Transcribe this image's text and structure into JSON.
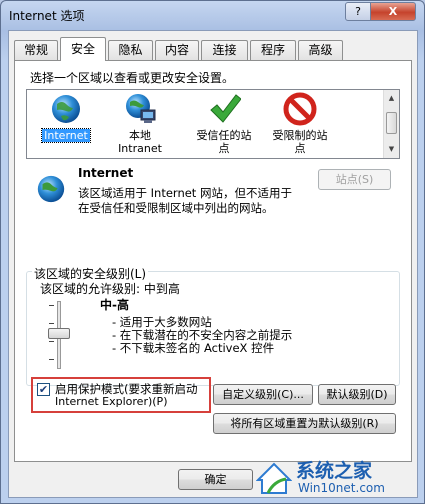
{
  "window": {
    "title": "Internet 选项",
    "help_label": "?",
    "close_label": "X"
  },
  "tabs": [
    {
      "label": "常规"
    },
    {
      "label": "安全"
    },
    {
      "label": "隐私"
    },
    {
      "label": "内容"
    },
    {
      "label": "连接"
    },
    {
      "label": "程序"
    },
    {
      "label": "高级"
    }
  ],
  "security": {
    "prompt": "选择一个区域以查看或更改安全设置。",
    "zones": [
      {
        "label_line1": "Internet",
        "label_line2": "",
        "icon": "globe-icon"
      },
      {
        "label_line1": "本地",
        "label_line2": "Intranet",
        "icon": "local-intranet-icon"
      },
      {
        "label_line1": "受信任的站",
        "label_line2": "点",
        "icon": "checkmark-icon"
      },
      {
        "label_line1": "受限制的站",
        "label_line2": "点",
        "icon": "no-entry-icon"
      }
    ],
    "selected_zone": {
      "name": "Internet",
      "desc_line1": "该区域适用于 Internet 网站，但不适用于",
      "desc_line2": "在受信任和受限制区域中列出的网站。"
    },
    "sites_button": "站点(S)",
    "level_group_label": "该区域的安全级别(L)",
    "allowed_levels": "该区域的允许级别: 中到高",
    "level_name": "中-高",
    "level_bullets": [
      "- 适用于大多数网站",
      "- 在下载潜在的不安全内容之前提示",
      "- 不下载未签名的 ActiveX 控件"
    ],
    "protected_mode": {
      "checked": true,
      "check_glyph": "✔",
      "label_line1": "启用保护模式(要求重新启动",
      "label_line2": "Internet Explorer)(P)"
    },
    "custom_level_button": "自定义级别(C)...",
    "default_level_button": "默认级别(D)",
    "reset_all_button": "将所有区域重置为默认级别(R)"
  },
  "footer": {
    "ok_button": "确定"
  },
  "watermark": {
    "brand": "系统之家",
    "url": "Win10net.com"
  },
  "colors": {
    "highlight": "#d6403b",
    "selection": "#3399ff"
  }
}
